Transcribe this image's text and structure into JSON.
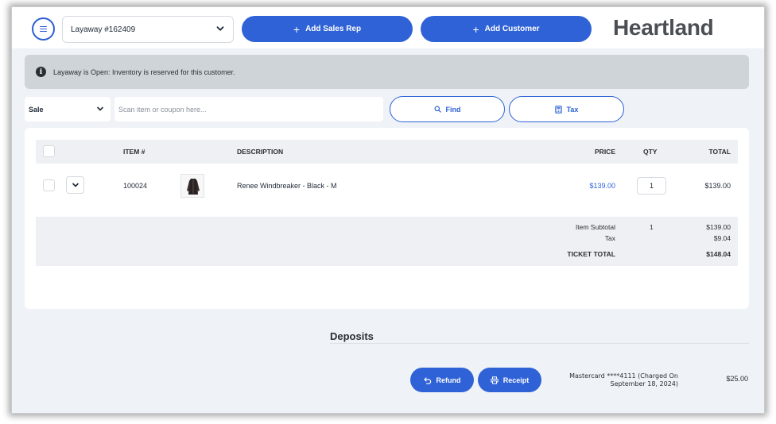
{
  "header": {
    "layaway_label": "Layaway #162409",
    "add_sales_rep": "Add Sales Rep",
    "add_customer": "Add Customer",
    "logo": "Heartland"
  },
  "banner": {
    "message": "Layaway is Open: Inventory is reserved for this customer."
  },
  "toolbar": {
    "mode": "Sale",
    "scan_placeholder": "Scan item or coupon here...",
    "find": "Find",
    "tax": "Tax"
  },
  "table": {
    "columns": {
      "item": "ITEM #",
      "description": "DESCRIPTION",
      "price": "PRICE",
      "qty": "QTY",
      "total": "TOTAL"
    },
    "rows": [
      {
        "item": "100024",
        "description": "Renee Windbreaker - Black - M",
        "price": "$139.00",
        "qty": "1",
        "total": "$139.00"
      }
    ]
  },
  "totals": {
    "subtotal_label": "Item Subtotal",
    "subtotal_qty": "1",
    "subtotal_value": "$139.00",
    "tax_label": "Tax",
    "tax_value": "$9.04",
    "ticket_total_label": "TICKET TOTAL",
    "ticket_total_value": "$148.04"
  },
  "deposits": {
    "title": "Deposits",
    "refund": "Refund",
    "receipt": "Receipt",
    "card_line1": "Mastercard ****4111 (Charged On",
    "card_line2": "September 18, 2024)",
    "amount": "$25.00"
  },
  "colors": {
    "accent": "#2e62d6",
    "banner_bg": "#cfd4d9",
    "page_bg": "#eff2f7",
    "logo": "#4b4f54"
  }
}
